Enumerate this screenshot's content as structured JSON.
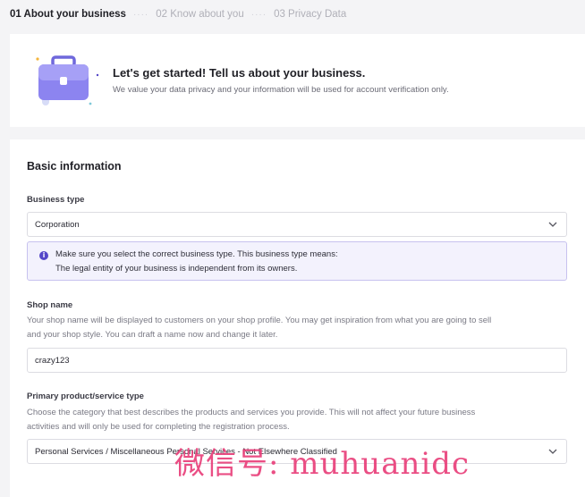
{
  "stepper": {
    "steps": [
      {
        "label": "01 About your business",
        "state": "active"
      },
      {
        "label": "02 Know about you",
        "state": "inactive"
      },
      {
        "label": "03 Privacy Data",
        "state": "inactive"
      }
    ],
    "separator": "····"
  },
  "hero": {
    "icon": "briefcase-icon",
    "title": "Let's get started! Tell us about your business.",
    "subtitle": "We value your data privacy and your information will be used for account verification only."
  },
  "basic_info": {
    "title": "Basic information",
    "business_type": {
      "label": "Business type",
      "value": "Corporation",
      "notice_line1": "Make sure you select the correct business type. This business type means:",
      "notice_line2": "The legal entity of your business is independent from its owners."
    },
    "shop_name": {
      "label": "Shop name",
      "help_line1": "Your shop name will be displayed to customers on your shop profile. You may get inspiration from what you are going to sell",
      "help_line2": "and your shop style. You can draft a name now and change it later.",
      "value": "crazy123"
    },
    "primary_product": {
      "label": "Primary product/service type",
      "help_line1": "Choose the category that best describes the products and services you provide. This will not affect your future business",
      "help_line2": "activities and will only be used for completing the registration process.",
      "value": "Personal Services / Miscellaneous Personal Services - Not Elsewhere Classified"
    }
  },
  "watermark": "微信号: muhuanidc",
  "colors": {
    "accent": "#5446c8",
    "notice_bg": "#f3f2fd",
    "notice_border": "#c7c2ef",
    "watermark": "#e9407a"
  }
}
